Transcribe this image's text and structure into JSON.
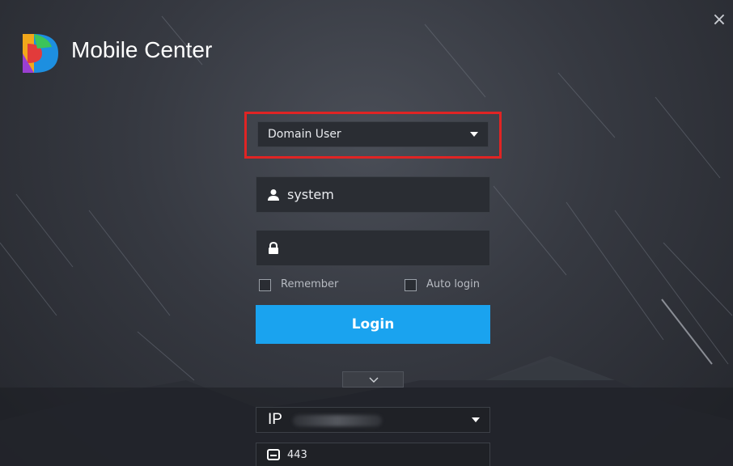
{
  "app": {
    "title": "Mobile Center",
    "close_label": "×"
  },
  "login_type": {
    "selected": "Domain User",
    "icon": "chevron-down-icon"
  },
  "username": {
    "value": "system",
    "icon": "user-icon"
  },
  "password": {
    "value": "",
    "icon": "lock-icon"
  },
  "options": {
    "remember_label": "Remember",
    "remember_checked": false,
    "auto_login_label": "Auto login",
    "auto_login_checked": false
  },
  "login_button": {
    "label": "Login"
  },
  "expander": {
    "icon": "chevron-down-icon"
  },
  "server": {
    "type_label": "IP",
    "address": ""
  },
  "port": {
    "value": "443",
    "icon": "port-icon"
  },
  "colors": {
    "accent": "#1aa3ef",
    "highlight_border": "#e02424",
    "background": "#363941"
  }
}
